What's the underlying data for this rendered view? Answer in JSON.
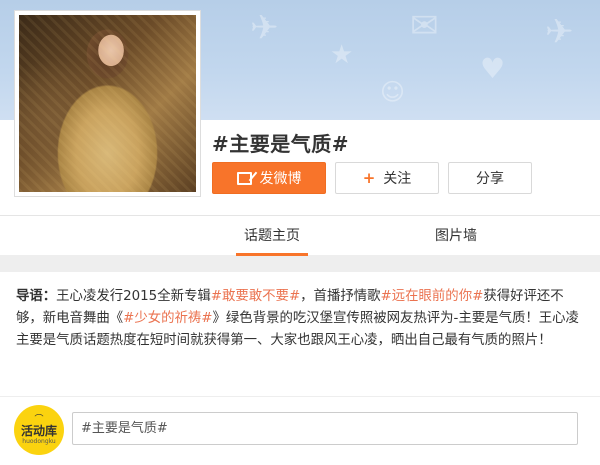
{
  "topic": {
    "title": "#主要是气质#"
  },
  "actions": {
    "post_label": "发微博",
    "follow_label": "关注",
    "follow_plus": "+",
    "share_label": "分享"
  },
  "tabs": [
    {
      "label": "话题主页",
      "active": true
    },
    {
      "label": "图片墙",
      "active": false
    }
  ],
  "lead": {
    "label": "导语：",
    "segments": [
      {
        "text": "王心凌发行2015全新专辑",
        "tag": false
      },
      {
        "text": "#敢要敢不要#",
        "tag": true
      },
      {
        "text": "，首播抒情歌",
        "tag": false
      },
      {
        "text": "#远在眼前的你#",
        "tag": true
      },
      {
        "text": "获得好评还不够，新电音舞曲《",
        "tag": false
      },
      {
        "text": "#少女的祈祷#",
        "tag": true
      },
      {
        "text": "》绿色背景的吃汉堡宣传照被网友热评为-主要是气质！王心凌主要是气质话题热度在短时间就获得第一、大家也跟风王心凌，晒出自己最有气质的照片！",
        "tag": false
      }
    ]
  },
  "comment": {
    "logo_top": "⌒",
    "logo_main": "活动库",
    "logo_sub": "huodongku",
    "value": "#主要是气质#"
  },
  "colors": {
    "accent": "#f8742a",
    "tag": "#eb7350",
    "logo_bg": "#fbd30f",
    "banner": "#c2d7ee"
  }
}
